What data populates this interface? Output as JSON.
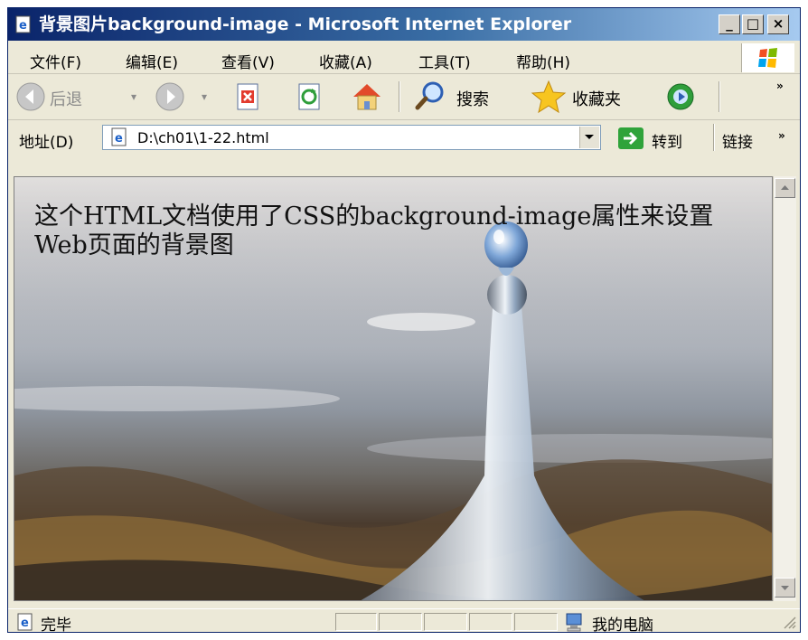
{
  "window": {
    "title": "背景图片background-image - Microsoft Internet Explorer",
    "minimize": "_",
    "maximize": "□",
    "close": "×"
  },
  "menu": [
    "文件(F)",
    "编辑(E)",
    "查看(V)",
    "收藏(A)",
    "工具(T)",
    "帮助(H)"
  ],
  "toolbar": {
    "back": "后退",
    "search": "搜索",
    "favorites": "收藏夹",
    "more": "»"
  },
  "address": {
    "label": "地址(D)",
    "value": "D:\\ch01\\1-22.html",
    "go": "转到",
    "links": "链接",
    "more": "»"
  },
  "content": {
    "text": "这个HTML文档使用了CSS的background-image属性来设置Web页面的背景图"
  },
  "status": {
    "text": "完毕",
    "zone": "我的电脑"
  },
  "colors": {
    "title_bar_start": "#0a246a",
    "title_bar_end": "#a6caf0",
    "chrome": "#ece9d8"
  }
}
